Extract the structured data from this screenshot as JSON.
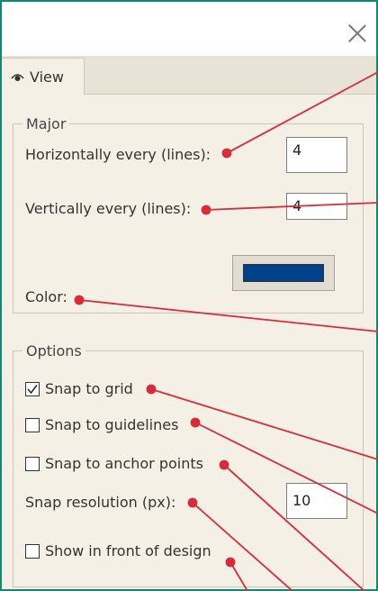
{
  "tab": {
    "label": "View",
    "icon": "eye-icon"
  },
  "major": {
    "legend": "Major",
    "horizontal_label": "Horizontally every (lines):",
    "horizontal_value": "4",
    "vertical_label": "Vertically every (lines):",
    "vertical_value": "4",
    "color_label": "Color:",
    "color_value": "#003f8a"
  },
  "options": {
    "legend": "Options",
    "snap_grid_label": "Snap to grid",
    "snap_grid_checked": true,
    "snap_guides_label": "Snap to guidelines",
    "snap_guides_checked": false,
    "snap_anchor_label": "Snap to anchor points",
    "snap_anchor_checked": false,
    "resolution_label": "Snap resolution (px):",
    "resolution_value": "10",
    "front_label": "Show in front of design",
    "front_checked": false
  },
  "colors": {
    "frame": "#0f8a6f",
    "annotation": "#d92b3a"
  }
}
